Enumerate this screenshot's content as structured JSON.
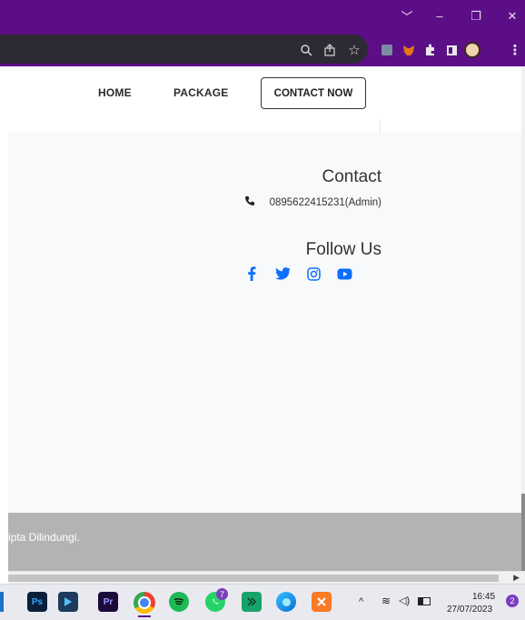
{
  "browser": {
    "window_controls": [
      "﹀",
      "–",
      "❐",
      "✕"
    ],
    "toolbar_icons": [
      "zoom-icon",
      "share-icon",
      "bookmark-star-icon",
      "extension-tile-icon",
      "metamask-icon",
      "extensions-puzzle-icon",
      "side-panel-icon",
      "profile-avatar-icon",
      "more-menu-icon"
    ]
  },
  "nav": {
    "home": "HOME",
    "package": "PACKAGE",
    "contact_now": "CONTACT NOW"
  },
  "footer": {
    "contact_title": "Contact",
    "phone": "0895622415231(Admin)",
    "follow_title": "Follow Us",
    "social": [
      "facebook-icon",
      "twitter-icon",
      "instagram-icon",
      "youtube-icon"
    ],
    "copyright_fragment": "ipta Dilindungi."
  },
  "taskbar": {
    "apps": [
      "Ps",
      "Pr"
    ],
    "whatsapp_badge": "7",
    "time": "16:45",
    "date": "27/07/2023",
    "notification_count": "2"
  },
  "colors": {
    "titlebar": "#5c0e87",
    "social_blue": "#0d6efd",
    "footer_bottom": "#b3b3b3"
  }
}
